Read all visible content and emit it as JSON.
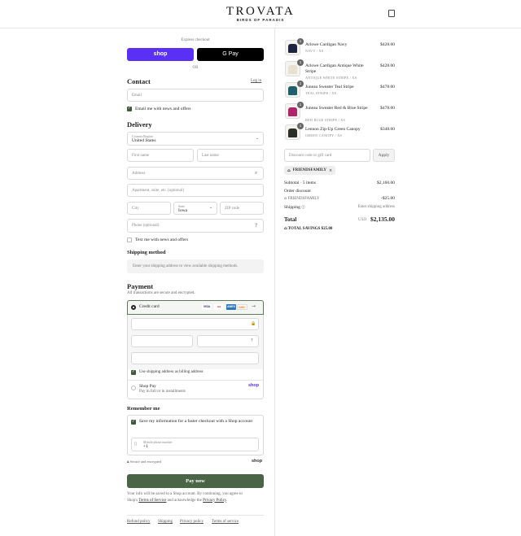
{
  "header": {
    "brand": "TROVATA",
    "tagline": "BIRDS OF PARADIS"
  },
  "express": {
    "label": "Express checkout",
    "shop_label": "shop",
    "gpay_label": "G Pay",
    "or": "OR"
  },
  "contact": {
    "title": "Contact",
    "login": "Log in",
    "email_placeholder": "Email",
    "news_label": "Email me with news and offers"
  },
  "delivery": {
    "title": "Delivery",
    "country_label": "Country/Region",
    "country_value": "United States",
    "first_placeholder": "First name",
    "last_placeholder": "Last name",
    "address_placeholder": "Address",
    "apt_placeholder": "Apartment, suite, etc. (optional)",
    "city_placeholder": "City",
    "state_label": "State",
    "state_value": "Iowa",
    "zip_placeholder": "ZIP code",
    "phone_placeholder": "Phone (optional)",
    "text_label": "Text me with news and offers"
  },
  "shipping": {
    "title": "Shipping method",
    "placeholder": "Enter your shipping address to view available shipping methods."
  },
  "payment": {
    "title": "Payment",
    "subtitle": "All transactions are secure and encrypted.",
    "credit_label": "Credit card",
    "card_logos": [
      "VISA",
      "MC",
      "AMEX",
      "DISC"
    ],
    "billing_label": "Use shipping address as billing address",
    "shoppay_label": "Shop Pay",
    "shoppay_sub": "Pay in full or in installments",
    "shoppay_logo": "shop"
  },
  "remember": {
    "title": "Remember me",
    "save_label": "Save my information for a faster checkout with a Shop account",
    "mobile_label": "Mobile phone number",
    "mobile_value": "+1",
    "secure": "Secure and encrypted",
    "shop_logo": "shop"
  },
  "pay_button": "Pay now",
  "disclaimer": {
    "text1": "Your info will be saved to a Shop account. By continuing, you agree to",
    "text2_pre": "Shop's ",
    "tos": "Terms of Service",
    "text2_mid": " and acknowledge the ",
    "privacy": "Privacy Policy",
    "text2_post": "."
  },
  "footer_links": [
    "Refund policy",
    "Shipping",
    "Privacy policy",
    "Terms of service"
  ],
  "cart": {
    "items": [
      {
        "name": "Arlowe Cardigan Navy",
        "variant": "NAVY / XS",
        "price": "$428.00",
        "qty": "1",
        "color": "#1d2440"
      },
      {
        "name": "Arlowe Cardigan Antique White Stripe",
        "variant": "ANTIQUE WHITE STRIPE / XS",
        "price": "$428.00",
        "qty": "1",
        "color": "#e8e1d2"
      },
      {
        "name": "Juneau Sweater Teal Stripe",
        "variant": "TEAL STRIPE / XS",
        "price": "$478.00",
        "qty": "1",
        "color": "#1f5e6b"
      },
      {
        "name": "Juneau Sweater Red & Blue Stripe",
        "variant": "RED BLUE STRIPE / XS",
        "price": "$478.00",
        "qty": "1",
        "color": "#b0246a"
      },
      {
        "name": "Lennon Zip-Up Green Canopy",
        "variant": "GREEN CANOPY / XS",
        "price": "$348.00",
        "qty": "1",
        "color": "#2a2f28"
      }
    ],
    "discount_placeholder": "Discount code or gift card",
    "apply": "Apply",
    "code": "FRIENDSFAMILY",
    "subtotal_label": "Subtotal · 5 items",
    "subtotal_value": "$2,160.00",
    "order_discount_label": "Order discount",
    "discount_code_line": "FRIENDSFAMILY",
    "discount_value": "-$25.00",
    "shipping_label": "Shipping",
    "shipping_value": "Enter shipping address",
    "total_label": "Total",
    "currency": "USD",
    "total_value": "$2,135.00",
    "savings_label": "TOTAL SAVINGS",
    "savings_value": "$25.00"
  }
}
